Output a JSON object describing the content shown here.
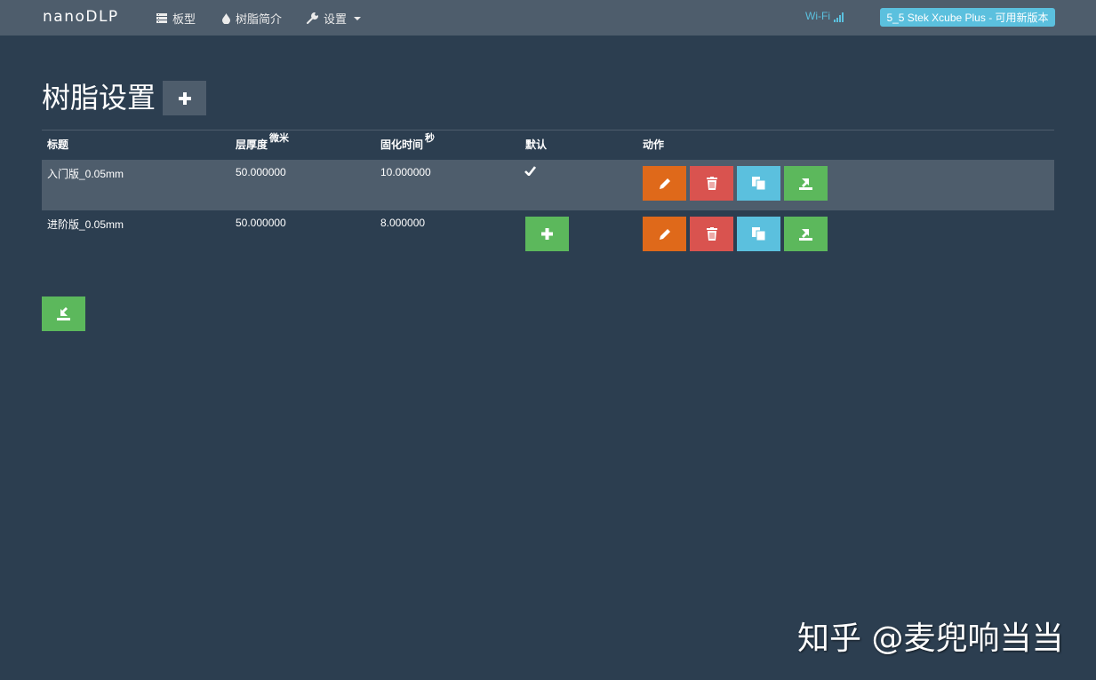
{
  "navbar": {
    "brand": "nanoDLP",
    "items": [
      {
        "label": "板型",
        "icon": "list-icon"
      },
      {
        "label": "树脂简介",
        "icon": "drop-icon"
      },
      {
        "label": "设置",
        "icon": "wrench-icon"
      }
    ],
    "wifi_label": "Wi-Fi",
    "version_badge": "5_5 Stek Xcube Plus - 可用新版本"
  },
  "page": {
    "title": "树脂设置"
  },
  "table": {
    "headers": {
      "title": "标题",
      "thickness": "层厚度",
      "thickness_unit": "微米",
      "cure_time": "固化时间",
      "cure_unit": "秒",
      "default": "默认",
      "actions": "动作"
    },
    "rows": [
      {
        "title": "入门版_0.05mm",
        "thickness": "50.000000",
        "cure_time": "10.000000",
        "is_default": true
      },
      {
        "title": "进阶版_0.05mm",
        "thickness": "50.000000",
        "cure_time": "8.000000",
        "is_default": false
      }
    ]
  },
  "watermark": "知乎 @麦兜响当当",
  "colors": {
    "background": "#2c3e50",
    "navbar": "#4e5d6c",
    "orange": "#df691a",
    "red": "#d9534f",
    "blue": "#5bc0de",
    "green": "#5cb85c"
  }
}
